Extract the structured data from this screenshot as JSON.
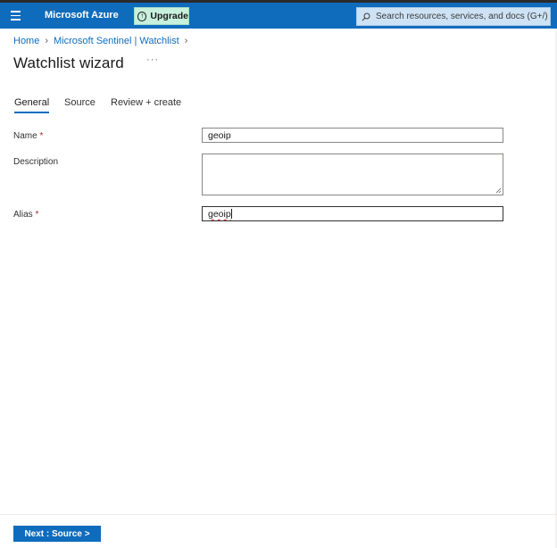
{
  "topbar": {
    "brand": "Microsoft Azure",
    "upgrade_label": "Upgrade",
    "search_placeholder": "Search resources, services, and docs (G+/)",
    "background": "#0f6cbd"
  },
  "breadcrumb": {
    "items": [
      "Home",
      "Microsoft Sentinel | Watchlist"
    ]
  },
  "page": {
    "title": "Watchlist wizard",
    "more_label": "···"
  },
  "tabs": [
    {
      "label": "General",
      "active": true
    },
    {
      "label": "Source",
      "active": false
    },
    {
      "label": "Review + create",
      "active": false
    }
  ],
  "form": {
    "name": {
      "label": "Name",
      "required_mark": "*",
      "value": "geoip"
    },
    "description": {
      "label": "Description",
      "value": ""
    },
    "alias": {
      "label": "Alias",
      "required_mark": "*",
      "value": "geoip"
    }
  },
  "footer": {
    "next_label": "Next : Source >"
  },
  "icons": [
    "menu-icon",
    "upgrade-icon",
    "search-icon",
    "chevron-right-icon",
    "resize-handle-icon"
  ]
}
